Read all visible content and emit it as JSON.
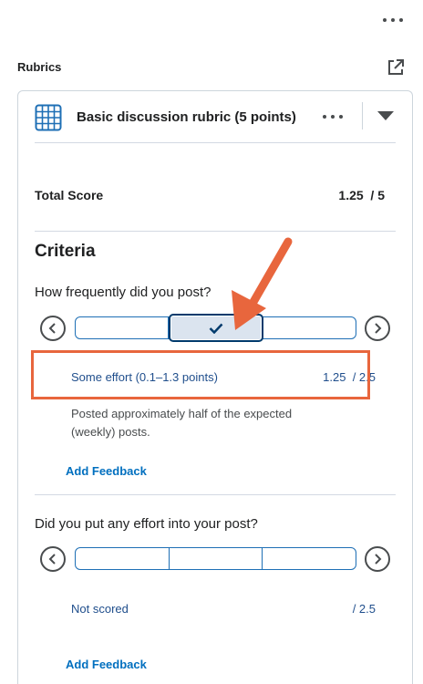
{
  "panel": {
    "menu_icon": "more-horizontal-icon",
    "section_title": "Rubrics",
    "popout_icon": "external-link-icon"
  },
  "rubric": {
    "icon": "grid-table-icon",
    "title": "Basic discussion rubric (5 points)",
    "menu_icon": "more-horizontal-icon",
    "expand_icon": "caret-down-icon",
    "total_label": "Total Score",
    "total_value": "1.25  / 5",
    "criteria_heading": "Criteria",
    "criteria": [
      {
        "question": "How frequently did you post?",
        "levels_count": 3,
        "selected_level": 2,
        "selected_icon": "checkmark-icon",
        "level_name": "Some effort (0.1–1.3 points)",
        "level_score": "1.25  / 2.5",
        "level_description": "Posted approximately half of the expected (weekly) posts.",
        "add_feedback": "Add Feedback"
      },
      {
        "question": "Did you put any effort into your post?",
        "levels_count": 3,
        "selected_level": null,
        "level_name": "Not scored",
        "level_score": "/ 2.5",
        "add_feedback": "Add Feedback"
      }
    ]
  },
  "colors": {
    "accent_blue": "#006fbf",
    "slider_border": "#1e6fb5",
    "selected_fill": "#dbe4ef",
    "annotation_orange": "#e8663d"
  }
}
